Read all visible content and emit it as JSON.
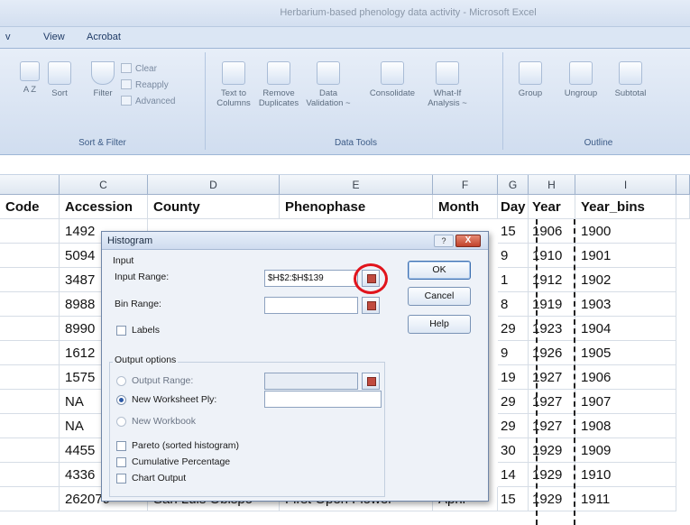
{
  "window": {
    "title": "Herbarium-based phenology data activity - Microsoft Excel"
  },
  "tabs": [
    {
      "label": "v"
    },
    {
      "label": "View"
    },
    {
      "label": "Acrobat"
    }
  ],
  "ribbon": {
    "sort_filter": {
      "label": "Sort & Filter",
      "sort": "Sort",
      "filter": "Filter",
      "clear": "Clear",
      "reapply": "Reapply",
      "advanced": "Advanced",
      "az": "A Z",
      "za": "Z A"
    },
    "data_tools": {
      "label": "Data Tools",
      "text_to_columns": "Text to Columns",
      "remove_duplicates": "Remove Duplicates",
      "data_validation": "Data Validation ~",
      "consolidate": "Consolidate",
      "what_if": "What-If Analysis ~"
    },
    "outline": {
      "label": "Outline",
      "group": "Group",
      "ungroup": "Ungroup",
      "subtotal": "Subtotal"
    }
  },
  "sheet": {
    "column_letters": [
      "",
      "C",
      "D",
      "E",
      "F",
      "G",
      "H",
      "I"
    ],
    "headers": [
      "Code",
      "Accession",
      "County",
      "Phenophase",
      "Month",
      "Day",
      "Year",
      "Year_bins"
    ],
    "rows": [
      {
        "accession": "1492",
        "day": "15",
        "year": "1906",
        "bin": "1900"
      },
      {
        "accession": "5094",
        "day": "9",
        "year": "1910",
        "bin": "1901"
      },
      {
        "accession": "3487",
        "day": "1",
        "year": "1912",
        "bin": "1902"
      },
      {
        "accession": "8988",
        "day": "8",
        "year": "1919",
        "bin": "1903"
      },
      {
        "accession": "8990",
        "day": "29",
        "year": "1923",
        "bin": "1904"
      },
      {
        "accession": "1612",
        "day": "9",
        "year": "1926",
        "bin": "1905"
      },
      {
        "accession": "1575",
        "day": "19",
        "year": "1927",
        "bin": "1906"
      },
      {
        "accession": "NA",
        "day": "29",
        "year": "1927",
        "bin": "1907"
      },
      {
        "accession": "NA",
        "day": "29",
        "year": "1927",
        "bin": "1908"
      },
      {
        "accession": "4455",
        "day": "30",
        "year": "1929",
        "bin": "1909"
      },
      {
        "accession": "4336",
        "day": "14",
        "year": "1929",
        "bin": "1910"
      },
      {
        "accession": "262079",
        "county": "San Luis Obispo",
        "phenophase": "First Open Flower",
        "month": "April",
        "day": "15",
        "year": "1929",
        "bin": "1911"
      }
    ]
  },
  "dialog": {
    "title": "Histogram",
    "help_glyph": "?",
    "close_glyph": "X",
    "input_section": "Input",
    "input_range_label": "Input Range:",
    "input_range_value": "$H$2:$H$139",
    "bin_range_label": "Bin Range:",
    "bin_range_value": "",
    "labels_label": "Labels",
    "output_section": "Output options",
    "output_range_label": "Output Range:",
    "new_worksheet_label": "New Worksheet Ply:",
    "new_workbook_label": "New Workbook",
    "pareto_label": "Pareto (sorted histogram)",
    "cumulative_label": "Cumulative Percentage",
    "chart_output_label": "Chart Output",
    "ok_label": "OK",
    "cancel_label": "Cancel",
    "help_label": "Help"
  }
}
